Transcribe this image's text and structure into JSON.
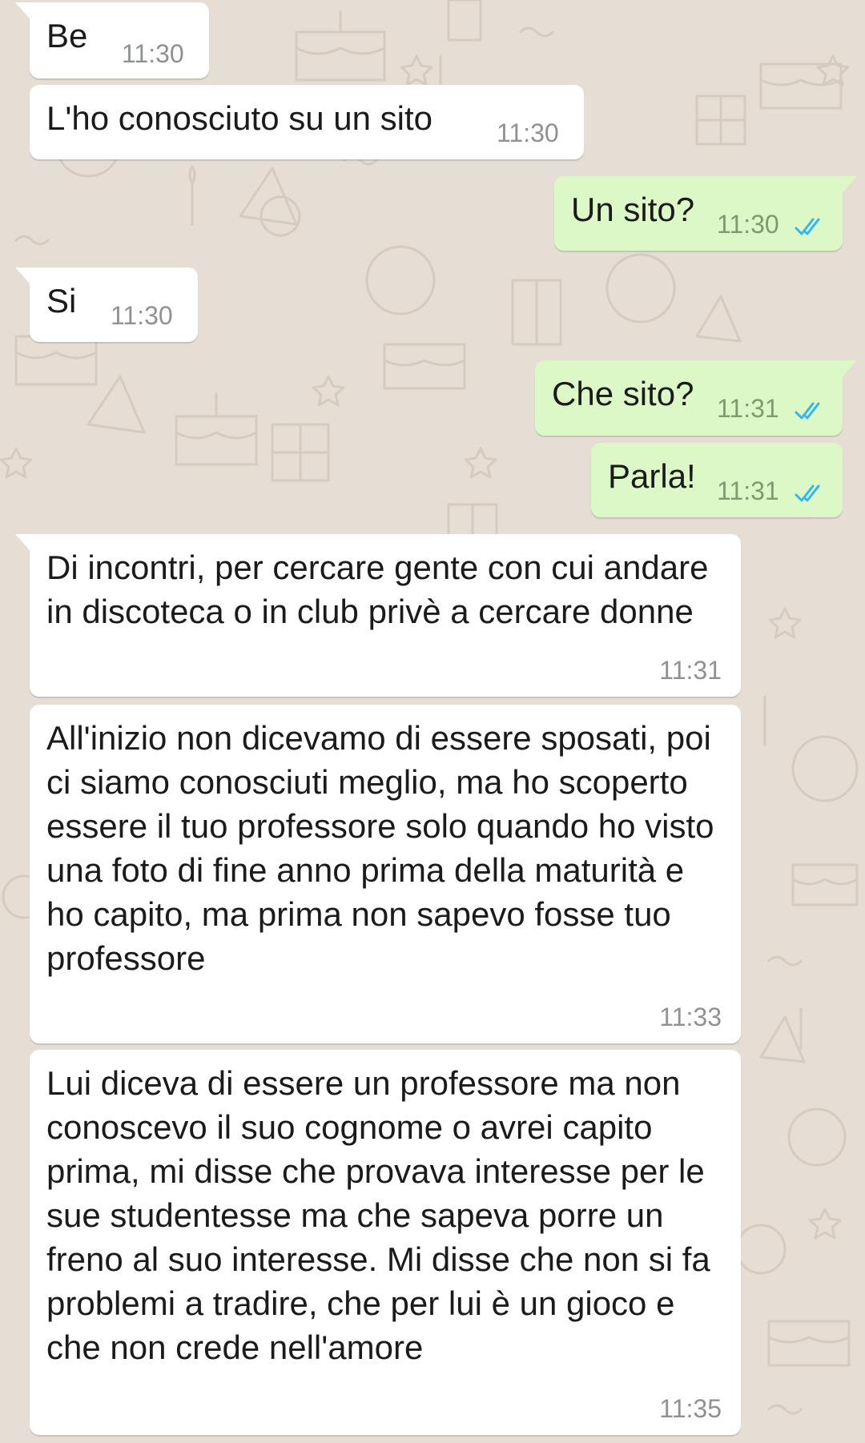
{
  "chat": {
    "read_tick_color": "#34b7f1",
    "incoming_bubble_color": "#ffffff",
    "outgoing_bubble_color": "#dcf8c6",
    "messages": [
      {
        "direction": "in",
        "text": "Be",
        "time": "11:30"
      },
      {
        "direction": "in",
        "text": "L'ho conosciuto su un sito",
        "time": "11:30"
      },
      {
        "direction": "out",
        "text": "Un sito?",
        "time": "11:30",
        "status": "read-double-check"
      },
      {
        "direction": "in",
        "text": "Si",
        "time": "11:30"
      },
      {
        "direction": "out",
        "text": "Che sito?",
        "time": "11:31",
        "status": "read-double-check"
      },
      {
        "direction": "out",
        "text": "Parla!",
        "time": "11:31",
        "status": "read-double-check"
      },
      {
        "direction": "in",
        "text": "Di incontri, per cercare gente con cui andare in discoteca o in club privè a cercare donne",
        "time": "11:31"
      },
      {
        "direction": "in",
        "text": "All'inizio non dicevamo di essere sposati, poi ci siamo conosciuti meglio, ma ho scoperto essere il tuo professore solo quando ho visto una foto di fine anno prima della maturità e ho capito, ma prima non sapevo fosse tuo professore",
        "time": "11:33"
      },
      {
        "direction": "in",
        "text": "Lui diceva di essere un professore ma non conoscevo il suo cognome o avrei capito prima, mi disse che provava interesse per le sue studentesse ma che sapeva porre un freno al suo interesse. Mi disse che non si fa problemi a tradire, che per lui è un gioco e che non crede nell'amore",
        "time": "11:35"
      }
    ]
  }
}
